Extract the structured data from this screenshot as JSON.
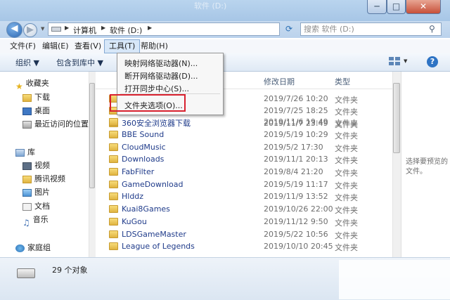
{
  "window": {
    "title": "软件 (D:)",
    "controls": {
      "min": "─",
      "max": "□",
      "close": "✕"
    }
  },
  "nav": {
    "back": "◀",
    "forward": "▶",
    "address": {
      "crumbs": [
        "计算机",
        "软件 (D:)"
      ]
    },
    "search_placeholder": "搜索 软件 (D:)"
  },
  "menubar": {
    "items": [
      "文件(F)",
      "编辑(E)",
      "查看(V)",
      "工具(T)",
      "帮助(H)"
    ]
  },
  "toolbar": {
    "organize": "组织 ▼",
    "include": "包含到库中 ▼"
  },
  "tools_menu": {
    "items": [
      "映射网络驱动器(N)...",
      "断开网络驱动器(D)...",
      "打开同步中心(S)...",
      "文件夹选项(O)..."
    ]
  },
  "navpane": {
    "favorites": {
      "label": "收藏夹",
      "items": [
        "下载",
        "桌面",
        "最近访问的位置"
      ]
    },
    "libraries": {
      "label": "库",
      "items": [
        "视频",
        "腾讯视频",
        "图片",
        "文档",
        "音乐"
      ]
    },
    "homegroup": "家庭组"
  },
  "columns": {
    "modified": "修改日期",
    "type": "类型"
  },
  "files": [
    {
      "name": "",
      "date": "2019/7/26 10:20",
      "type": "文件夹"
    },
    {
      "name": "",
      "date": "2019/7/25 18:25",
      "type": "文件夹"
    },
    {
      "name": "",
      "date": "2019/11/7 23:49",
      "type": "文件夹"
    },
    {
      "name": "360安全浏览器下载",
      "date": "2019/11/6 19:49",
      "type": "文件夹"
    },
    {
      "name": "BBE Sound",
      "date": "2019/5/19 10:29",
      "type": "文件夹"
    },
    {
      "name": "CloudMusic",
      "date": "2019/5/2 17:30",
      "type": "文件夹"
    },
    {
      "name": "Downloads",
      "date": "2019/11/1 20:13",
      "type": "文件夹"
    },
    {
      "name": "FabFilter",
      "date": "2019/8/4 21:20",
      "type": "文件夹"
    },
    {
      "name": "GameDownload",
      "date": "2019/5/19 11:17",
      "type": "文件夹"
    },
    {
      "name": "Hlddz",
      "date": "2019/11/9 13:52",
      "type": "文件夹"
    },
    {
      "name": "Kuai8Games",
      "date": "2019/10/26 22:00",
      "type": "文件夹"
    },
    {
      "name": "KuGou",
      "date": "2019/11/12 9:50",
      "type": "文件夹"
    },
    {
      "name": "LDSGameMaster",
      "date": "2019/5/22 10:56",
      "type": "文件夹"
    },
    {
      "name": "League of Legends",
      "date": "2019/10/10 20:45",
      "type": "文件夹"
    }
  ],
  "preview": {
    "text": "选择要预览的文件。"
  },
  "status": {
    "count": "29 个对象"
  }
}
